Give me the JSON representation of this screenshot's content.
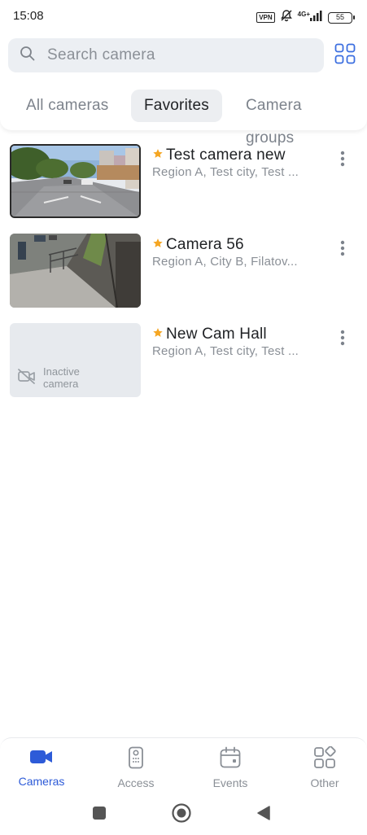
{
  "status_bar": {
    "time": "15:08",
    "vpn": "VPN",
    "network": "4G+",
    "battery": "55"
  },
  "search": {
    "placeholder": "Search camera",
    "icon": "search-icon"
  },
  "view_toggle": {
    "icon": "grid-view-icon"
  },
  "tabs": [
    {
      "label": "All cameras",
      "active": false
    },
    {
      "label": "Favorites",
      "active": true
    },
    {
      "label": "Camera groups",
      "active": false
    }
  ],
  "cameras": [
    {
      "name": "Test camera new",
      "address": "Region A, Test city, Test ...",
      "favorite": true,
      "status": "active"
    },
    {
      "name": "Camera 56",
      "address": "Region A, City B,  Filatov...",
      "favorite": true,
      "status": "active"
    },
    {
      "name": "New Cam Hall",
      "address": "Region A, Test city, Test ...",
      "favorite": true,
      "status": "inactive",
      "inactive_label": "Inactive camera"
    }
  ],
  "bottom_nav": [
    {
      "label": "Cameras",
      "icon": "video-camera-icon",
      "active": true
    },
    {
      "label": "Access",
      "icon": "intercom-icon",
      "active": false
    },
    {
      "label": "Events",
      "icon": "calendar-icon",
      "active": false
    },
    {
      "label": "Other",
      "icon": "apps-icon",
      "active": false
    }
  ],
  "colors": {
    "accent": "#2d5bd8",
    "star": "#f5a623",
    "muted_text": "#8a8f96"
  }
}
